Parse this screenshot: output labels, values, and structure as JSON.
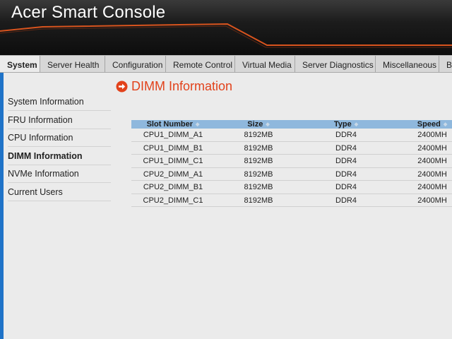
{
  "app": {
    "title": "Acer Smart Console"
  },
  "nav": {
    "tabs": [
      {
        "label": "System",
        "active": true
      },
      {
        "label": "Server Health"
      },
      {
        "label": "Configuration"
      },
      {
        "label": "Remote Control"
      },
      {
        "label": "Virtual Media"
      },
      {
        "label": "Server Diagnostics"
      },
      {
        "label": "Miscellaneous"
      },
      {
        "label": "B"
      }
    ]
  },
  "sidebar": {
    "items": [
      {
        "label": "System Information"
      },
      {
        "label": "FRU Information"
      },
      {
        "label": "CPU Information"
      },
      {
        "label": "DIMM Information",
        "active": true
      },
      {
        "label": "NVMe Information"
      },
      {
        "label": "Current Users"
      }
    ]
  },
  "main": {
    "title": "DIMM Information",
    "table": {
      "headers": [
        "Slot Number",
        "Size",
        "Type",
        "Speed"
      ],
      "rows": [
        [
          "CPU1_DIMM_A1",
          "8192MB",
          "DDR4",
          "2400MH"
        ],
        [
          "CPU1_DIMM_B1",
          "8192MB",
          "DDR4",
          "2400MH"
        ],
        [
          "CPU1_DIMM_C1",
          "8192MB",
          "DDR4",
          "2400MH"
        ],
        [
          "CPU2_DIMM_A1",
          "8192MB",
          "DDR4",
          "2400MH"
        ],
        [
          "CPU2_DIMM_B1",
          "8192MB",
          "DDR4",
          "2400MH"
        ],
        [
          "CPU2_DIMM_C1",
          "8192MB",
          "DDR4",
          "2400MH"
        ]
      ]
    }
  },
  "colors": {
    "accent_bar": "#1f73c8",
    "title_red": "#e2421b",
    "header_line": "#d9541e",
    "table_header": "#8fb8dd"
  }
}
